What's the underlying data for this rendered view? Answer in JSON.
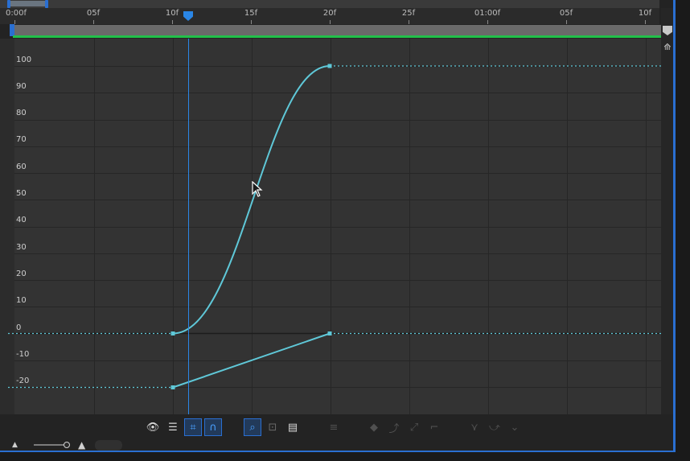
{
  "ruler": {
    "ticks": [
      "0:00f",
      "05f",
      "10f",
      "15f",
      "20f",
      "25f",
      "01:00f",
      "05f",
      "10f"
    ]
  },
  "y_axis": {
    "labels": [
      "100",
      "90",
      "80",
      "70",
      "60",
      "50",
      "40",
      "30",
      "20",
      "10",
      "0",
      "-10",
      "-20"
    ]
  },
  "colors": {
    "curve": "#5fc8d8",
    "playhead": "#2a86e6",
    "work_area_end": "#22c04a",
    "accent": "#2a6fd1"
  },
  "toolbar": {
    "icons": [
      "show-properties-icon",
      "graph-type-options-icon",
      "transform-box-icon",
      "snap-icon",
      "fit-selection-icon",
      "fit-all-icon",
      "separate-dimensions-icon",
      "edit-keyframe-icon",
      "hold-keyframe-icon",
      "linear-keyframe-icon",
      "auto-bezier-keyframe-icon",
      "easy-ease-icon",
      "easy-ease-in-icon",
      "easy-ease-out-icon"
    ]
  }
}
